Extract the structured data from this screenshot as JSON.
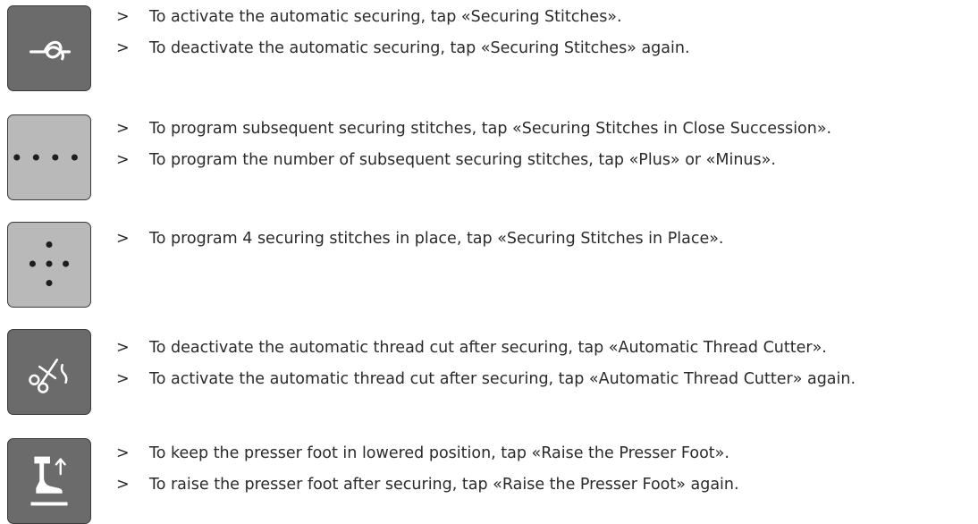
{
  "sections": [
    {
      "icon": "securing-stitches-knot-icon",
      "button_style": "dark",
      "lines": [
        "To activate the automatic securing, tap «Securing Stitches».",
        "To deactivate the automatic securing, tap «Securing Stitches» again."
      ]
    },
    {
      "icon": "securing-stitches-close-succession-icon",
      "button_style": "light",
      "lines": [
        "To program subsequent securing stitches, tap «Securing Stitches in Close Succession».",
        "To program the number of subsequent securing stitches, tap «Plus» or «Minus»."
      ]
    },
    {
      "icon": "securing-stitches-in-place-icon",
      "button_style": "light",
      "lines": [
        "To program 4 securing stitches in place, tap «Securing Stitches in Place»."
      ]
    },
    {
      "icon": "thread-cutter-scissors-icon",
      "button_style": "dark",
      "lines": [
        "To deactivate the automatic thread cut after securing, tap «Automatic Thread Cutter».",
        "To activate the automatic thread cut after securing, tap «Automatic Thread Cutter» again."
      ]
    },
    {
      "icon": "presser-foot-raise-icon",
      "button_style": "dark",
      "lines": [
        "To keep the presser foot in lowered position, tap «Raise the Presser Foot».",
        "To raise the presser foot after securing, tap «Raise the Presser Foot» again."
      ]
    }
  ],
  "bullet_marker": ">",
  "colors": {
    "button_dark": "#6b6b6b",
    "button_light": "#b9b9b9",
    "button_border": "#3a3a3a",
    "text": "#2a2a2a"
  }
}
